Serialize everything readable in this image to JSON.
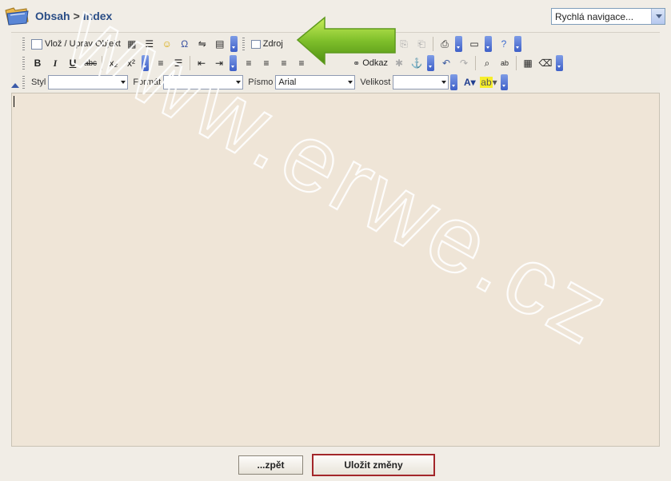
{
  "header": {
    "crumb_parent": "Obsah",
    "crumb_sep": ">",
    "crumb_current": "Index",
    "quick_nav": "Rychlá navigace..."
  },
  "toolbar": {
    "insert_object": "Vlož / Uprav Objekt",
    "source": "Zdroj",
    "link": "Odkaz",
    "style_label": "Styl",
    "style_value": "",
    "format_label": "Formát",
    "format_value": "",
    "font_label": "Písmo",
    "font_value": "Arial",
    "size_label": "Velikost",
    "size_value": ""
  },
  "editor": {
    "content": ""
  },
  "footer": {
    "back_label": "...zpět",
    "save_label": "Uložit změny"
  },
  "watermark": "www.erwe.cz",
  "colors": {
    "accent": "#2a4d86",
    "editor_bg": "#efe5d7",
    "save_border": "#a3262a",
    "arrow": "#7fbf2b"
  }
}
